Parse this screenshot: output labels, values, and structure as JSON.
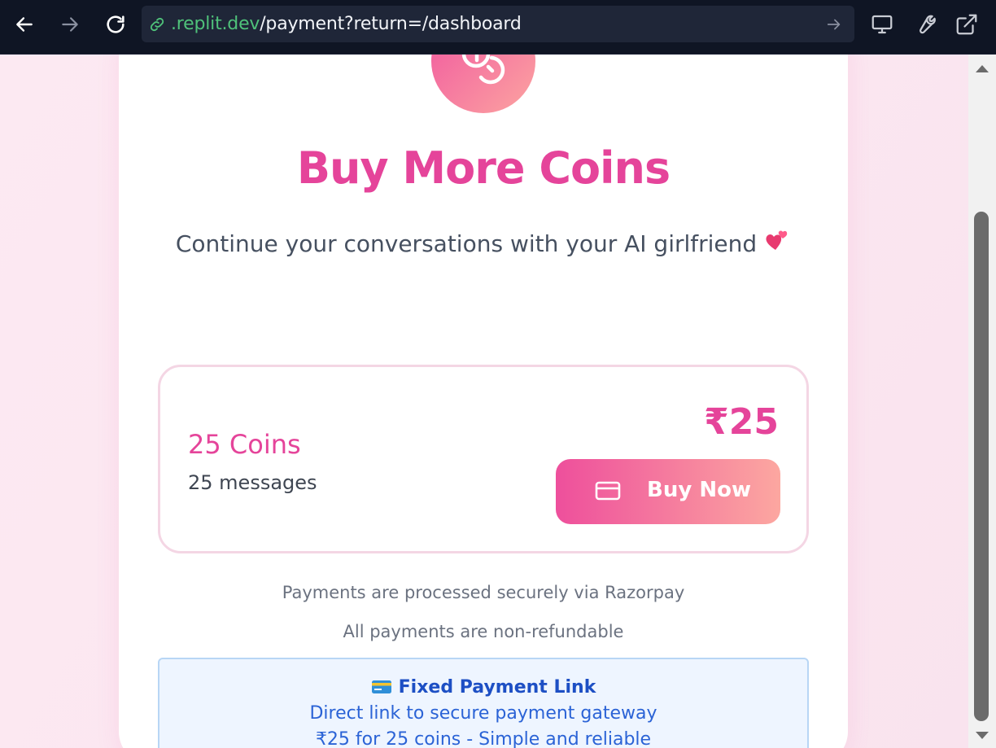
{
  "browser": {
    "url_domain": ".replit.dev",
    "url_path": "/payment?return=/dashboard"
  },
  "page": {
    "title": "Buy More Coins",
    "subtitle": "Continue your conversations with your AI girlfriend"
  },
  "plan": {
    "name": "25 Coins",
    "description": "25 messages",
    "price": "₹25",
    "button_label": "Buy Now"
  },
  "notes": {
    "secure": "Payments are processed securely via Razorpay",
    "refund": "All payments are non-refundable"
  },
  "info": {
    "title": "Fixed Payment Link",
    "line1": "Direct link to secure payment gateway",
    "line2": "₹25 for 25 coins - Simple and reliable"
  },
  "colors": {
    "accent": "#e5449a",
    "gradient_start": "#ee4f9c",
    "gradient_end": "#fca7a0",
    "info_text": "#2b63d6"
  }
}
